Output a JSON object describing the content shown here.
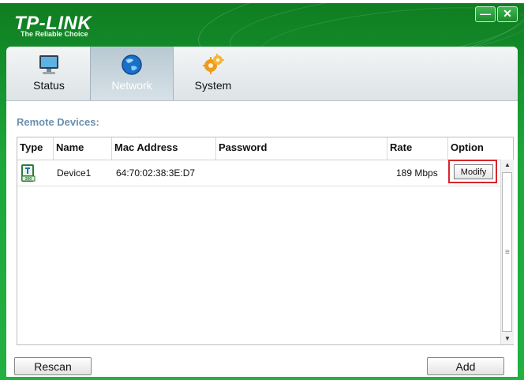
{
  "brand": {
    "logo": "TP-LINK",
    "tagline": "The Reliable Choice"
  },
  "window_controls": {
    "minimize": "—",
    "close": "✕"
  },
  "tabs": [
    {
      "label": "Status",
      "icon": "monitor-icon"
    },
    {
      "label": "Network",
      "icon": "globe-icon",
      "active": true
    },
    {
      "label": "System",
      "icon": "gears-icon"
    }
  ],
  "section_title": "Remote Devices:",
  "table": {
    "columns": [
      "Type",
      "Name",
      "Mac Address",
      "Password",
      "Rate",
      "Option"
    ],
    "rows": [
      {
        "type_icon": "powerline-adapter-icon",
        "name": "Device1",
        "mac": "64:70:02:38:3E:D7",
        "password": "",
        "rate": "189 Mbps",
        "option": "Modify"
      }
    ]
  },
  "buttons": {
    "rescan": "Rescan",
    "add": "Add"
  },
  "colors": {
    "brand_green": "#1da63a",
    "section_title": "#6a8fb0",
    "highlight": "#d8262b"
  }
}
